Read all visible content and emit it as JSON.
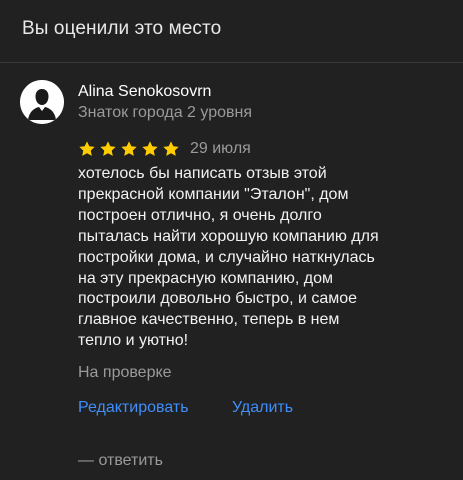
{
  "section": {
    "title": "Вы оценили это место"
  },
  "review": {
    "author": {
      "name": "Alina Senokosovrn",
      "level": "Знаток города 2 уровня",
      "avatar_icon": "user-silhouette-icon"
    },
    "rating": 5,
    "rating_max": 5,
    "star_color": "#ffcc00",
    "date": "29 июля",
    "text_lines": [
      "хотелось бы написать отзыв этой",
      "прекрасной компании \"Эталон\", дом",
      "построен отлично, я очень долго",
      "пыталась найти хорошую компанию для",
      "постройки дома, и случайно наткнулась",
      "на эту прекрасную компанию, дом",
      "построили довольно быстро, и самое",
      "главное качественно, теперь в нем",
      "тепло и уютно!"
    ],
    "status": "На проверке"
  },
  "actions": {
    "edit_label": "Редактировать",
    "delete_label": "Удалить",
    "reply_label": "— ответить",
    "link_color": "#3f8efc"
  }
}
